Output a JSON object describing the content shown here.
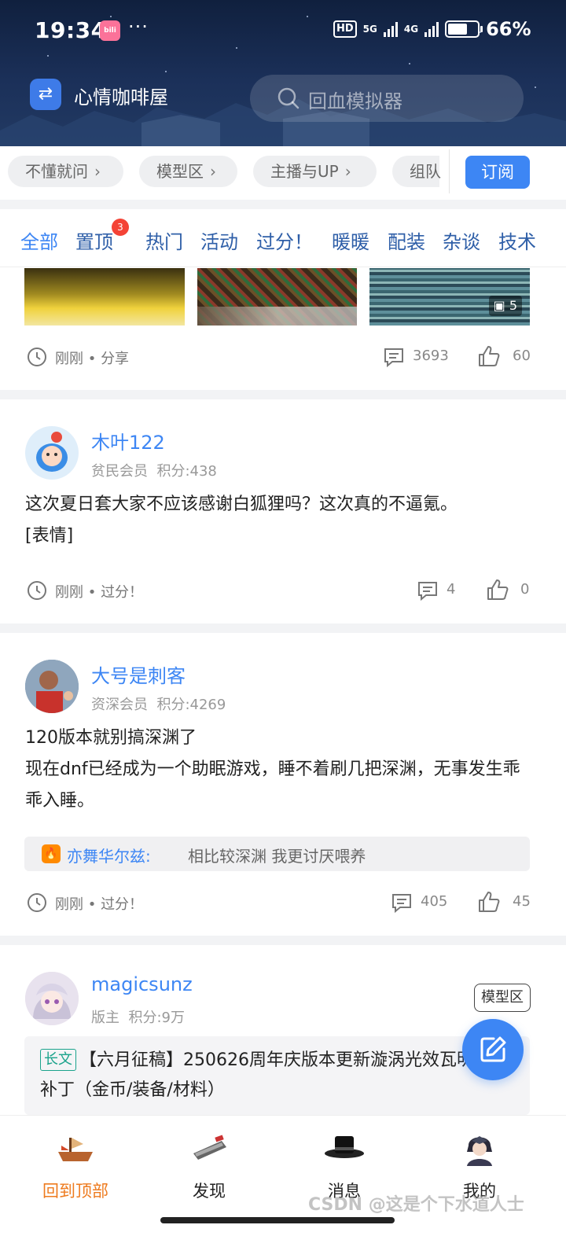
{
  "status_bar": {
    "time": "19:34",
    "app_badge": "bili",
    "more": "···",
    "hd_label": "HD",
    "net_5g": "5G",
    "net_4g": "4G",
    "battery": "66%"
  },
  "header": {
    "forum_name": "心情咖啡屋",
    "search_placeholder": "回血模拟器"
  },
  "chips": [
    "不懂就问",
    "模型区",
    "主播与UP",
    "组队"
  ],
  "subscribe_label": "订阅",
  "tabs": [
    {
      "label": "全部",
      "active": true
    },
    {
      "label": "置顶",
      "badge": "3"
    },
    {
      "label": "热门"
    },
    {
      "label": "活动"
    },
    {
      "label": "过分！"
    },
    {
      "label": "暖暖"
    },
    {
      "label": "配装"
    },
    {
      "label": "杂谈"
    },
    {
      "label": "技术"
    }
  ],
  "posts": [
    {
      "image_count": "5",
      "time": "刚刚",
      "category": "分享",
      "comments": "3693",
      "likes": "60"
    },
    {
      "username": "木叶122",
      "rank": "贫民会员",
      "points": "积分:438",
      "body": [
        "这次夏日套大家不应该感谢白狐狸吗？这次真的不逼氪。",
        "[表情]"
      ],
      "time": "刚刚",
      "category": "过分！",
      "comments": "4",
      "likes": "0"
    },
    {
      "username": "大号是刺客",
      "rank": "资深会员",
      "points": "积分:4269",
      "body": [
        "120版本就别搞深渊了",
        "现在dnf已经成为一个助眠游戏，睡不着刷几把深渊，无事发生乖乖入睡。"
      ],
      "reply_user": "亦舞华尔兹:",
      "reply_text": "相比较深渊 我更讨厌喂养",
      "time": "刚刚",
      "category": "过分！",
      "comments": "405",
      "likes": "45"
    },
    {
      "username": "magicsunz",
      "rank": "版主",
      "points": "积分:9万",
      "tag": "模型区",
      "long_label": "长文",
      "long_title": "【六月征稿】250626周年庆版本更新漩涡光效瓦明显化补丁（金币/装备/材料）"
    }
  ],
  "bottom_nav": [
    {
      "label": "回到顶部",
      "icon": "ship-icon",
      "active": true
    },
    {
      "label": "发现",
      "icon": "discover-icon"
    },
    {
      "label": "消息",
      "icon": "hat-icon"
    },
    {
      "label": "我的",
      "icon": "profile-avatar-icon"
    }
  ],
  "watermark": "CSDN @这是个下水道人士",
  "colors": {
    "accent": "#3d86f4",
    "active_nav": "#ee7b1f",
    "badge": "#f44336",
    "long_tag": "#1ba38c"
  }
}
